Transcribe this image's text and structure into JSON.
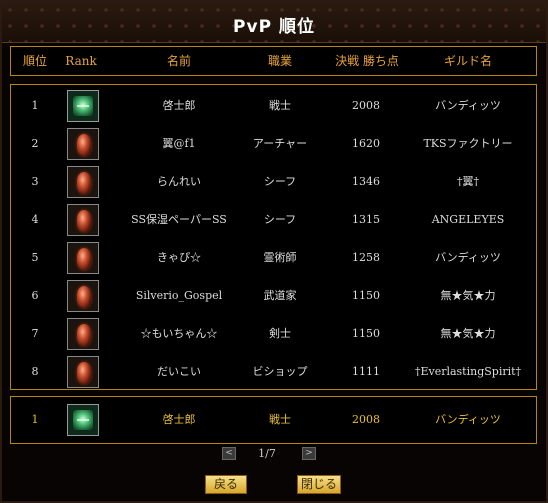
{
  "title": "PvP 順位",
  "header": [
    "順位",
    "Rank",
    "名前",
    "職業",
    "決戦 勝ち点",
    "ギルド名"
  ],
  "rows": [
    {
      "rank": "1",
      "name": "啓士郎",
      "job": "戦士",
      "points": "2008",
      "guild": "バンディッツ",
      "icon": "emerald-rank-icon"
    },
    {
      "rank": "2",
      "name": "翼@f1",
      "job": "アーチャー",
      "points": "1620",
      "guild": "TKSファクトリー",
      "icon": "ruby-rank-icon"
    },
    {
      "rank": "3",
      "name": "らんれい",
      "job": "シーフ",
      "points": "1346",
      "guild": "†翼†",
      "icon": "ruby-rank-icon"
    },
    {
      "rank": "4",
      "name": "SS保湿ペーパーSS",
      "job": "シーフ",
      "points": "1315",
      "guild": "ANGELEYES",
      "icon": "ruby-rank-icon"
    },
    {
      "rank": "5",
      "name": "きゃぴ☆",
      "job": "霊術師",
      "points": "1258",
      "guild": "バンディッツ",
      "icon": "ruby-rank-icon"
    },
    {
      "rank": "6",
      "name": "Silverio_Gospel",
      "job": "武道家",
      "points": "1150",
      "guild": "無★気★力",
      "icon": "ruby-rank-icon"
    },
    {
      "rank": "7",
      "name": "☆もいちゃん☆",
      "job": "剣士",
      "points": "1150",
      "guild": "無★気★力",
      "icon": "ruby-rank-icon"
    },
    {
      "rank": "8",
      "name": "だいこい",
      "job": "ビショップ",
      "points": "1111",
      "guild": "†EverlastingSpirit†",
      "icon": "ruby-rank-icon"
    }
  ],
  "mine": {
    "rank": "1",
    "name": "啓士郎",
    "job": "戦士",
    "points": "2008",
    "guild": "バンディッツ",
    "icon": "emerald-rank-icon"
  },
  "pager": {
    "prev": "<",
    "text": "1/7",
    "next": ">"
  },
  "buttons": {
    "back": "戻る",
    "close": "閉じる"
  }
}
